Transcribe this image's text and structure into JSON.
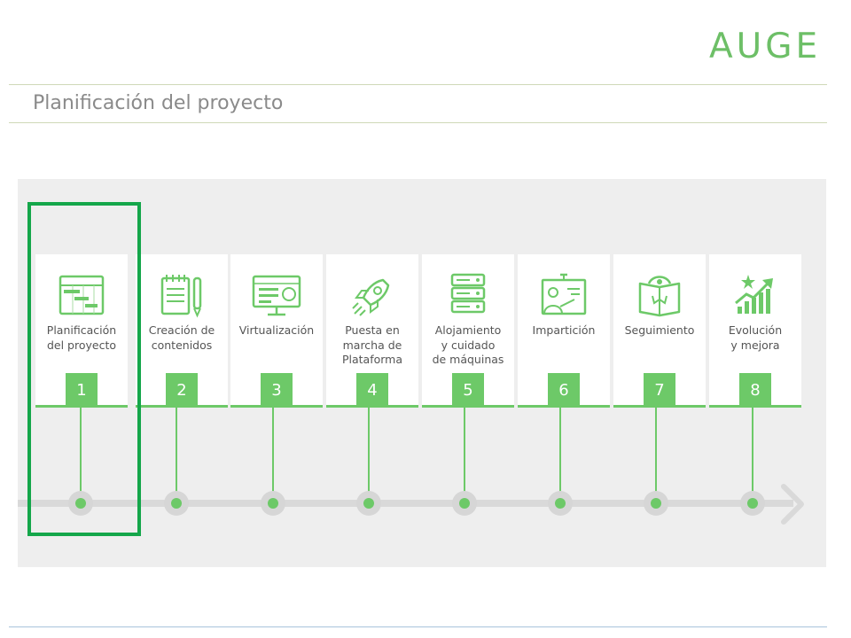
{
  "header": {
    "logo_text": "AUGE",
    "page_title": "Planificación del proyecto"
  },
  "colors": {
    "accent_green": "#6dc968",
    "highlight_green": "#14a64a",
    "timeline_gray": "#d9d9d9",
    "panel_bg": "#eeeeee"
  },
  "steps": [
    {
      "number": "1",
      "label": "Planificación\ndel proyecto",
      "icon": "gantt-chart-icon"
    },
    {
      "number": "2",
      "label": "Creación de\ncontenidos",
      "icon": "notepad-pen-icon"
    },
    {
      "number": "3",
      "label": "Virtualización",
      "icon": "monitor-icon"
    },
    {
      "number": "4",
      "label": "Puesta en\nmarcha de\nPlataforma",
      "icon": "rocket-icon"
    },
    {
      "number": "5",
      "label": "Alojamiento\ny cuidado\nde máquinas",
      "icon": "server-stack-icon"
    },
    {
      "number": "6",
      "label": "Impartición",
      "icon": "teacher-board-icon"
    },
    {
      "number": "7",
      "label": "Seguimiento",
      "icon": "book-eye-icon"
    },
    {
      "number": "8",
      "label": "Evolución\ny mejora",
      "icon": "growth-chart-icon"
    }
  ],
  "highlighted_step": "1"
}
